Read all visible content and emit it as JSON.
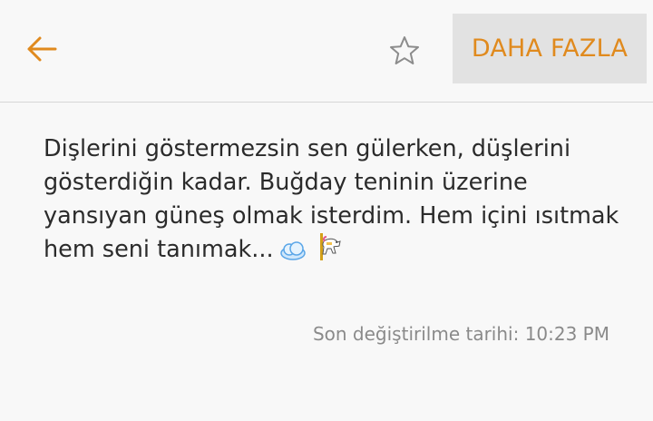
{
  "toolbar": {
    "back_icon": "arrow-left-icon",
    "favorite_icon": "star-outline-icon",
    "more_label": "DAHA FAZLA",
    "accent_color": "#e08a1e"
  },
  "note": {
    "text": "Dişlerini göstermezsin sen gülerken, düşlerini gösterdiğin kadar. Buğday teninin üzerine yansıyan güneş olmak isterdim. Hem içini ısıtmak hem seni tanımak...",
    "emojis": [
      "cloud-emoji",
      "carousel-horse-emoji"
    ]
  },
  "meta": {
    "modified_text": "Son değiştirilme tarihi: 10:23 PM"
  }
}
